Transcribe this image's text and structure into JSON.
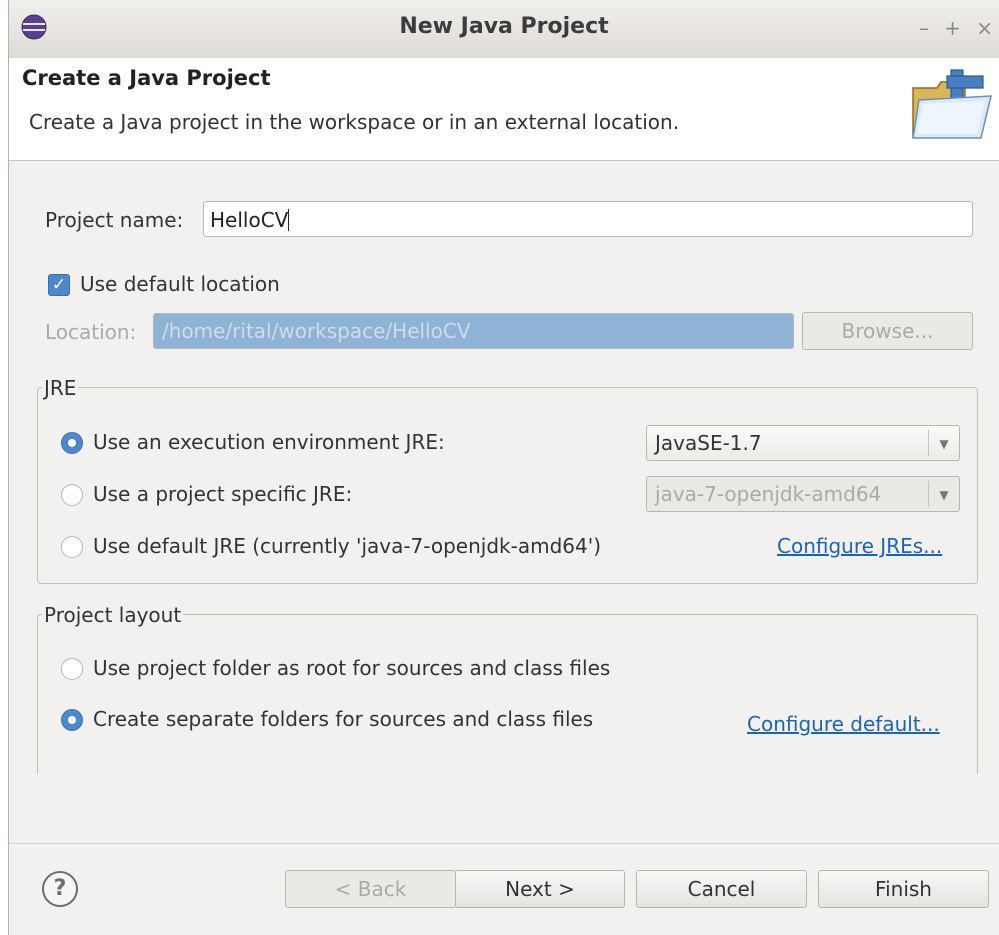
{
  "window": {
    "title": "New Java Project",
    "controls": [
      "–",
      "+",
      "×"
    ]
  },
  "header": {
    "title": "Create a Java Project",
    "description": "Create a Java project in the workspace or in an external location."
  },
  "project_name": {
    "label": "Project name:",
    "value": "HelloCV"
  },
  "default_location": {
    "label": "Use default location",
    "checked": true
  },
  "location": {
    "label": "Location:",
    "value": "/home/rital/workspace/HelloCV",
    "browse_label": "Browse..."
  },
  "jre": {
    "group_title": "JRE",
    "options": [
      {
        "label": "Use an execution environment JRE:",
        "selected": true,
        "combo": "JavaSE-1.7"
      },
      {
        "label": "Use a project specific JRE:",
        "selected": false,
        "combo": "java-7-openjdk-amd64"
      },
      {
        "label": "Use default JRE (currently 'java-7-openjdk-amd64')",
        "selected": false
      }
    ],
    "configure_link": "Configure JREs..."
  },
  "layout": {
    "group_title": "Project layout",
    "options": [
      {
        "label": "Use project folder as root for sources and class files",
        "selected": false
      },
      {
        "label": "Create separate folders for sources and class files",
        "selected": true
      }
    ],
    "configure_link": "Configure default..."
  },
  "footer": {
    "help": "?",
    "back": "< Back",
    "next": "Next >",
    "cancel": "Cancel",
    "finish": "Finish"
  }
}
